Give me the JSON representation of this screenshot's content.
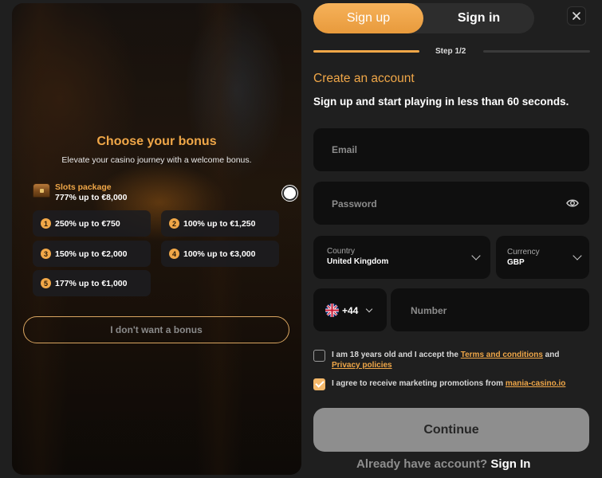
{
  "bonus": {
    "title": "Choose your bonus",
    "subtitle": "Elevate your casino journey with a welcome bonus.",
    "package": {
      "name": "Slots package",
      "amount": "777% up to €8,000",
      "selected": true
    },
    "tiers": [
      {
        "num": "1",
        "label": "250% up to €750"
      },
      {
        "num": "2",
        "label": "100% up to €1,250"
      },
      {
        "num": "3",
        "label": "150% up to €2,000"
      },
      {
        "num": "4",
        "label": "100% up to €3,000"
      },
      {
        "num": "5",
        "label": "177% up to €1,000"
      }
    ],
    "no_bonus": "I don't want a bonus"
  },
  "tabs": {
    "signup": "Sign up",
    "signin": "Sign in"
  },
  "step": {
    "label": "Step 1/2"
  },
  "form": {
    "heading": "Create an account",
    "tagline": "Sign up and start playing in less than 60 seconds.",
    "email_placeholder": "Email",
    "password_placeholder": "Password",
    "country_label": "Country",
    "country_value": "United Kingdom",
    "currency_label": "Currency",
    "currency_value": "GBP",
    "phone_code": "+44",
    "number_placeholder": "Number",
    "terms_pre": "I am 18 years old and I accept the ",
    "terms_link": "Terms and conditions",
    "terms_and": " and",
    "privacy_link": "Privacy policies",
    "terms_checked": false,
    "marketing_pre": "I agree to receive marketing promotions from ",
    "marketing_link": "mania-casino.io",
    "marketing_checked": true,
    "continue": "Continue",
    "footer_question": "Already have account?",
    "footer_signin": "Sign In"
  },
  "colors": {
    "accent": "#f0a748",
    "field_bg": "#0f0f0f",
    "panel_bg": "#1f1f1f",
    "button_disabled": "#8e8e8e"
  },
  "icons": [
    "treasure-chest-icon",
    "close-icon",
    "eye-icon",
    "chevron-down-icon",
    "uk-flag-icon",
    "checkmark-icon"
  ]
}
